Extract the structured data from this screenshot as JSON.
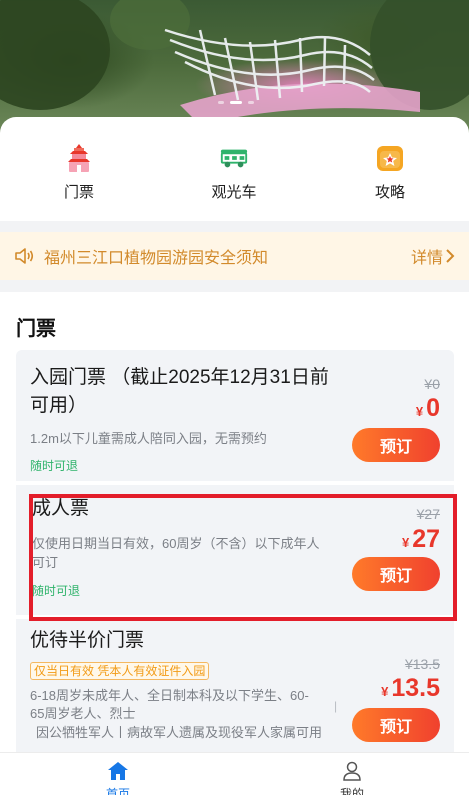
{
  "banner": {
    "slide_count": 3,
    "active_slide": 1
  },
  "quick_entries": [
    {
      "label": "门票",
      "icon": "pagoda-icon"
    },
    {
      "label": "观光车",
      "icon": "sightseeing-cart-icon"
    },
    {
      "label": "攻略",
      "icon": "guide-star-icon"
    }
  ],
  "notice": {
    "text": "福州三江口植物园游园安全须知",
    "more": "详情"
  },
  "tickets_section": {
    "title": "门票",
    "tickets": [
      {
        "name_line1": "入园门票 （截止2025年12月31日前",
        "name_line2": "可用）",
        "desc": "1.2m以下儿童需成人陪同入园，无需预约",
        "refund": "随时可退",
        "original_price": "¥0",
        "currency": "¥",
        "price": "0",
        "button": "预订"
      },
      {
        "name_line1": "成人票",
        "desc_line1": "仅使用日期当日有效，60周岁（不含）以下成年人",
        "desc_line2": "可订",
        "refund": "随时可退",
        "original_price": "¥27",
        "currency": "¥",
        "price": "27",
        "button": "预订"
      },
      {
        "name_line1": "优待半价门票",
        "tag": "仅当日有效 凭本人有效证件入园",
        "desc_line1": "6-18周岁未成年人、全日制本科及以下学生、60-",
        "desc_line2": "65周岁老人、烈士",
        "desc_line3": "因公牺牲军人丨病故军人遗属及现役军人家属可用",
        "original_price": "¥13.5",
        "currency": "¥",
        "price": "13.5",
        "button": "预订"
      }
    ]
  },
  "tabbar": {
    "home": {
      "label": "首页"
    },
    "mine": {
      "label": "我的"
    }
  },
  "colors": {
    "accent_red": "#e8372b",
    "refund_green": "#2fb36b",
    "notice_orange": "#d28a2b",
    "tab_active": "#1677e6"
  }
}
